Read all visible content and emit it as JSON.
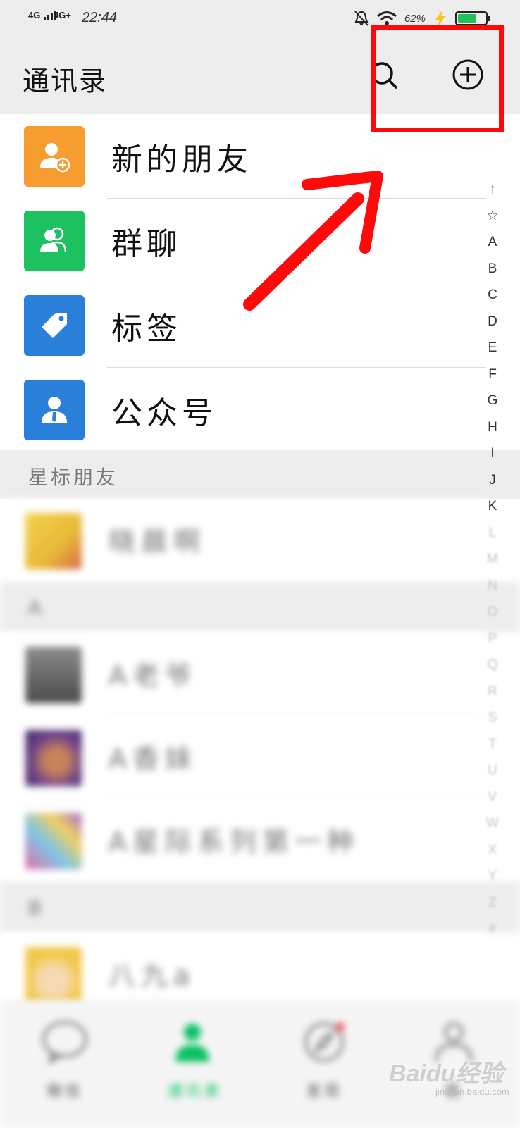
{
  "status_bar": {
    "signal1": "4G",
    "signal2": "4G+",
    "time": "22:44",
    "battery_percent": "62%"
  },
  "header": {
    "title": "通讯录",
    "search_icon": "search-icon",
    "add_icon": "plus-circle-icon"
  },
  "menu": [
    {
      "label": "新的朋友",
      "icon": "add-friend-icon",
      "color": "#f79c2e"
    },
    {
      "label": "群聊",
      "icon": "group-icon",
      "color": "#1ec15f"
    },
    {
      "label": "标签",
      "icon": "tag-icon",
      "color": "#2a7fd8"
    },
    {
      "label": "公众号",
      "icon": "official-account-icon",
      "color": "#2a7fd8"
    }
  ],
  "starred_header": "星标朋友",
  "section_a": "A",
  "section_b": "B",
  "contacts": [
    {
      "name": "晓晨啊"
    },
    {
      "name": "A老爷"
    },
    {
      "name": "A香妹"
    },
    {
      "name": "A星际系列第一种"
    },
    {
      "name": "八九a"
    }
  ],
  "index_letters": [
    "↑",
    "☆",
    "A",
    "B",
    "C",
    "D",
    "E",
    "F",
    "G",
    "H",
    "I",
    "J",
    "K"
  ],
  "index_faint": [
    "L",
    "M",
    "N",
    "O",
    "P",
    "Q",
    "R",
    "S",
    "T",
    "U",
    "V",
    "W",
    "X",
    "Y",
    "Z",
    "#"
  ],
  "tabs": [
    {
      "label": "微信",
      "icon": "chat-bubble-icon"
    },
    {
      "label": "通讯录",
      "icon": "contacts-icon"
    },
    {
      "label": "发现",
      "icon": "compass-icon"
    },
    {
      "label": "我",
      "icon": "profile-icon"
    }
  ],
  "colors": {
    "accent_green": "#07c160",
    "highlight_red": "#ff0a0a",
    "header_bg": "#ededed"
  },
  "watermark": {
    "brand": "Baidu经验",
    "url": "jingyan.baidu.com"
  }
}
